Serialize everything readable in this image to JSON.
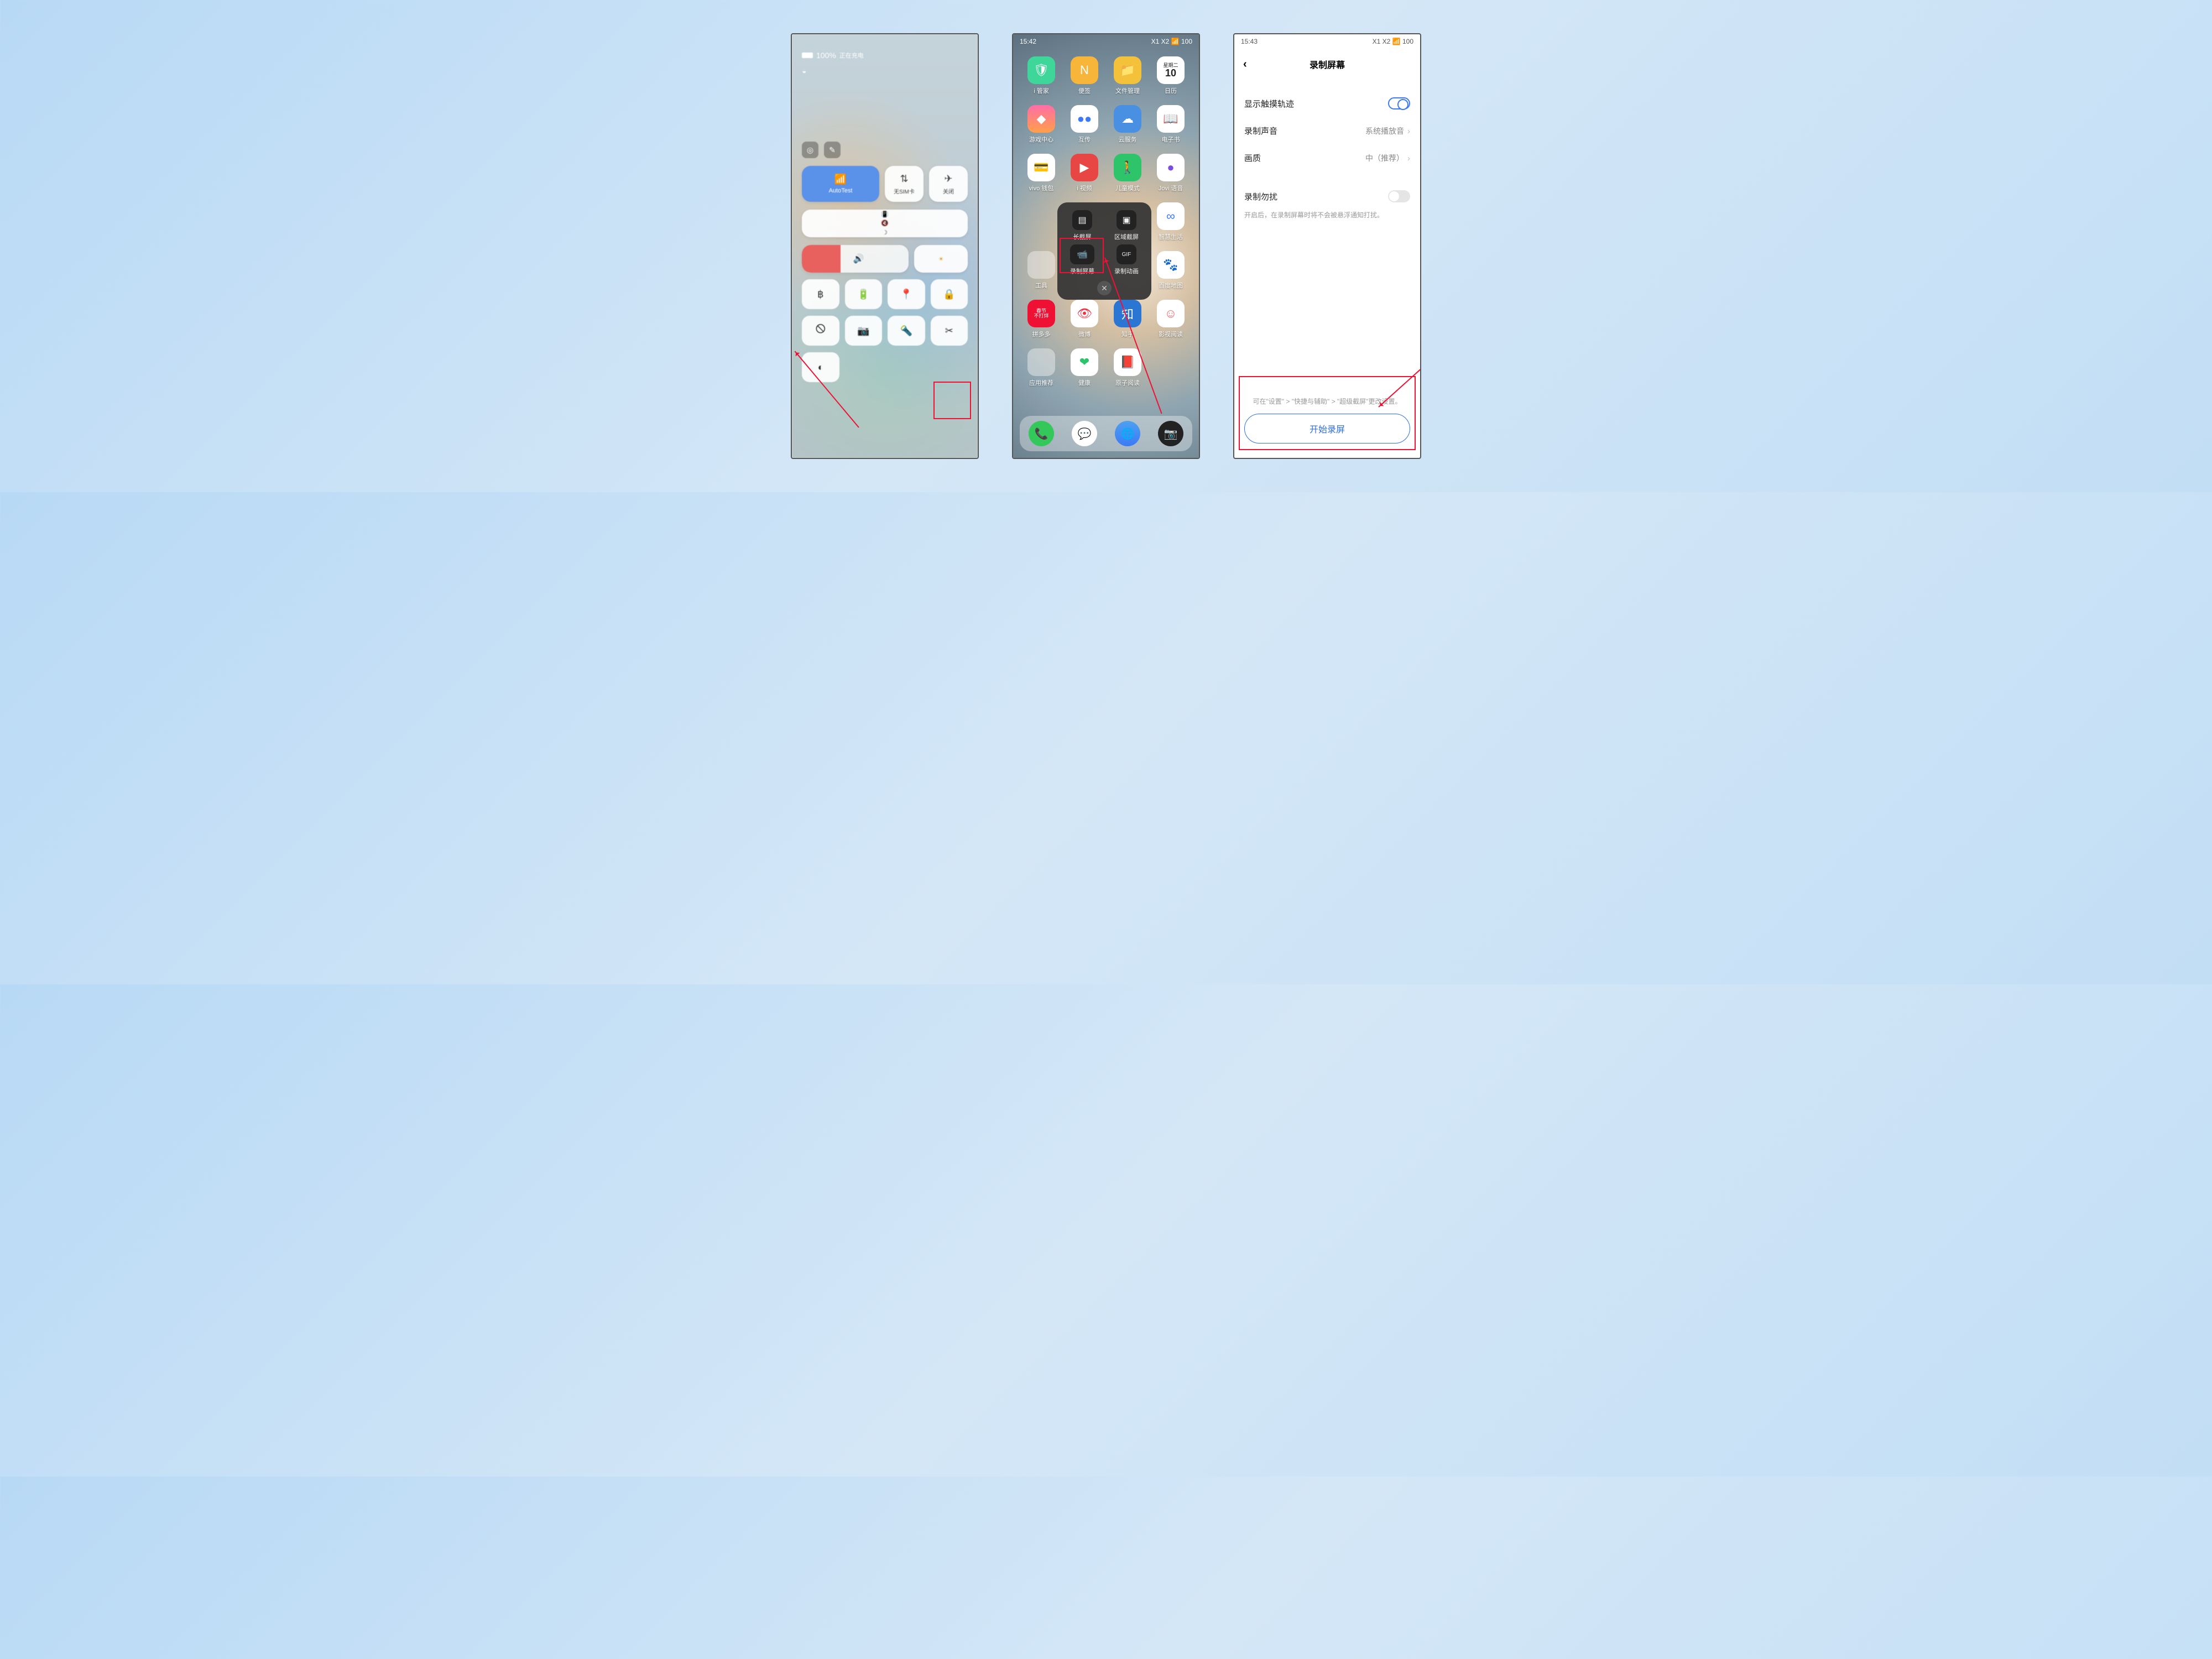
{
  "p1": {
    "battery": "100%",
    "charge_label": "正在充电",
    "wifi_label": "AutoTest",
    "sim_label": "无SIM卡",
    "airplane_label": "关闭"
  },
  "p2": {
    "time": "15:42",
    "battery": "100",
    "apps": {
      "r1": [
        "i 管家",
        "便签",
        "文件管理",
        "日历"
      ],
      "r2": [
        "游戏中心",
        "互传",
        "云服务",
        "电子书"
      ],
      "r3": [
        "vivo 钱包",
        "i 视频",
        "儿童模式",
        "Jovi 语音"
      ],
      "r4": [
        "",
        "",
        "",
        "智慧生活"
      ],
      "r5": [
        "工具",
        "",
        "",
        "百度地图"
      ],
      "r6": [
        "拼多多",
        "微博",
        "知乎",
        "影视阅读"
      ],
      "r7": [
        "应用推荐",
        "健康",
        "原子阅读",
        ""
      ]
    },
    "cal_top": "星期二",
    "cal_day": "10",
    "popover": {
      "long": "长截屏",
      "area": "区域截屏",
      "record": "录制屏幕",
      "gif": "录制动画"
    }
  },
  "p3": {
    "time": "15:43",
    "battery": "100",
    "title": "录制屏幕",
    "touch_trace": "显示触摸轨迹",
    "sound_label": "录制声音",
    "sound_value": "系统播放音",
    "quality_label": "画质",
    "quality_value": "中（推荐）",
    "dnd_label": "录制勿扰",
    "dnd_sub": "开启后，在录制屏幕时将不会被悬浮通知打扰。",
    "hint": "可在\"设置\" > \"快捷与辅助\" > \"超级截屏\"更改设置。",
    "start": "开始录屏"
  }
}
